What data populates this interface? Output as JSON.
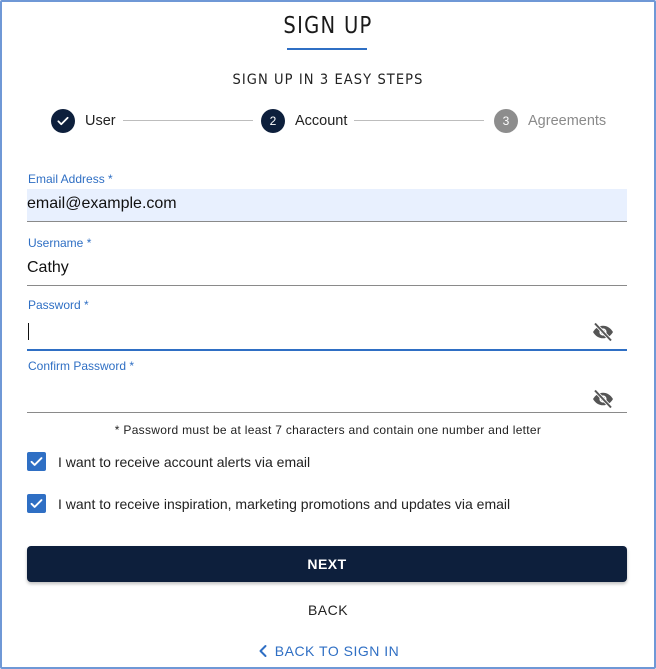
{
  "header": {
    "title": "SIGN UP",
    "subtitle": "SIGN UP IN 3 EASY STEPS"
  },
  "stepper": {
    "steps": [
      {
        "label": "User",
        "number": "1",
        "state": "done",
        "icon": "check-icon"
      },
      {
        "label": "Account",
        "number": "2",
        "state": "active"
      },
      {
        "label": "Agreements",
        "number": "3",
        "state": "pending"
      }
    ]
  },
  "form": {
    "email": {
      "label": "Email Address *",
      "value": "email@example.com"
    },
    "username": {
      "label": "Username *",
      "value": "Cathy"
    },
    "password": {
      "label": "Password *",
      "value": "",
      "icon": "eye-off-icon"
    },
    "confirm_password": {
      "label": "Confirm Password *",
      "value": "",
      "icon": "eye-off-icon"
    },
    "password_hint": "* Password must be at least 7 characters and contain one number and letter",
    "checkboxes": [
      {
        "label": "I want to receive account alerts via email",
        "checked": true
      },
      {
        "label": "I want to receive inspiration, marketing promotions and updates via email",
        "checked": true
      }
    ]
  },
  "actions": {
    "next_label": "NEXT",
    "back_label": "BACK",
    "signin_label": "BACK TO SIGN IN"
  },
  "colors": {
    "primary_dark": "#0d1f3c",
    "accent_blue": "#2f6fc4",
    "autofill_bg": "#e8f0fe"
  }
}
